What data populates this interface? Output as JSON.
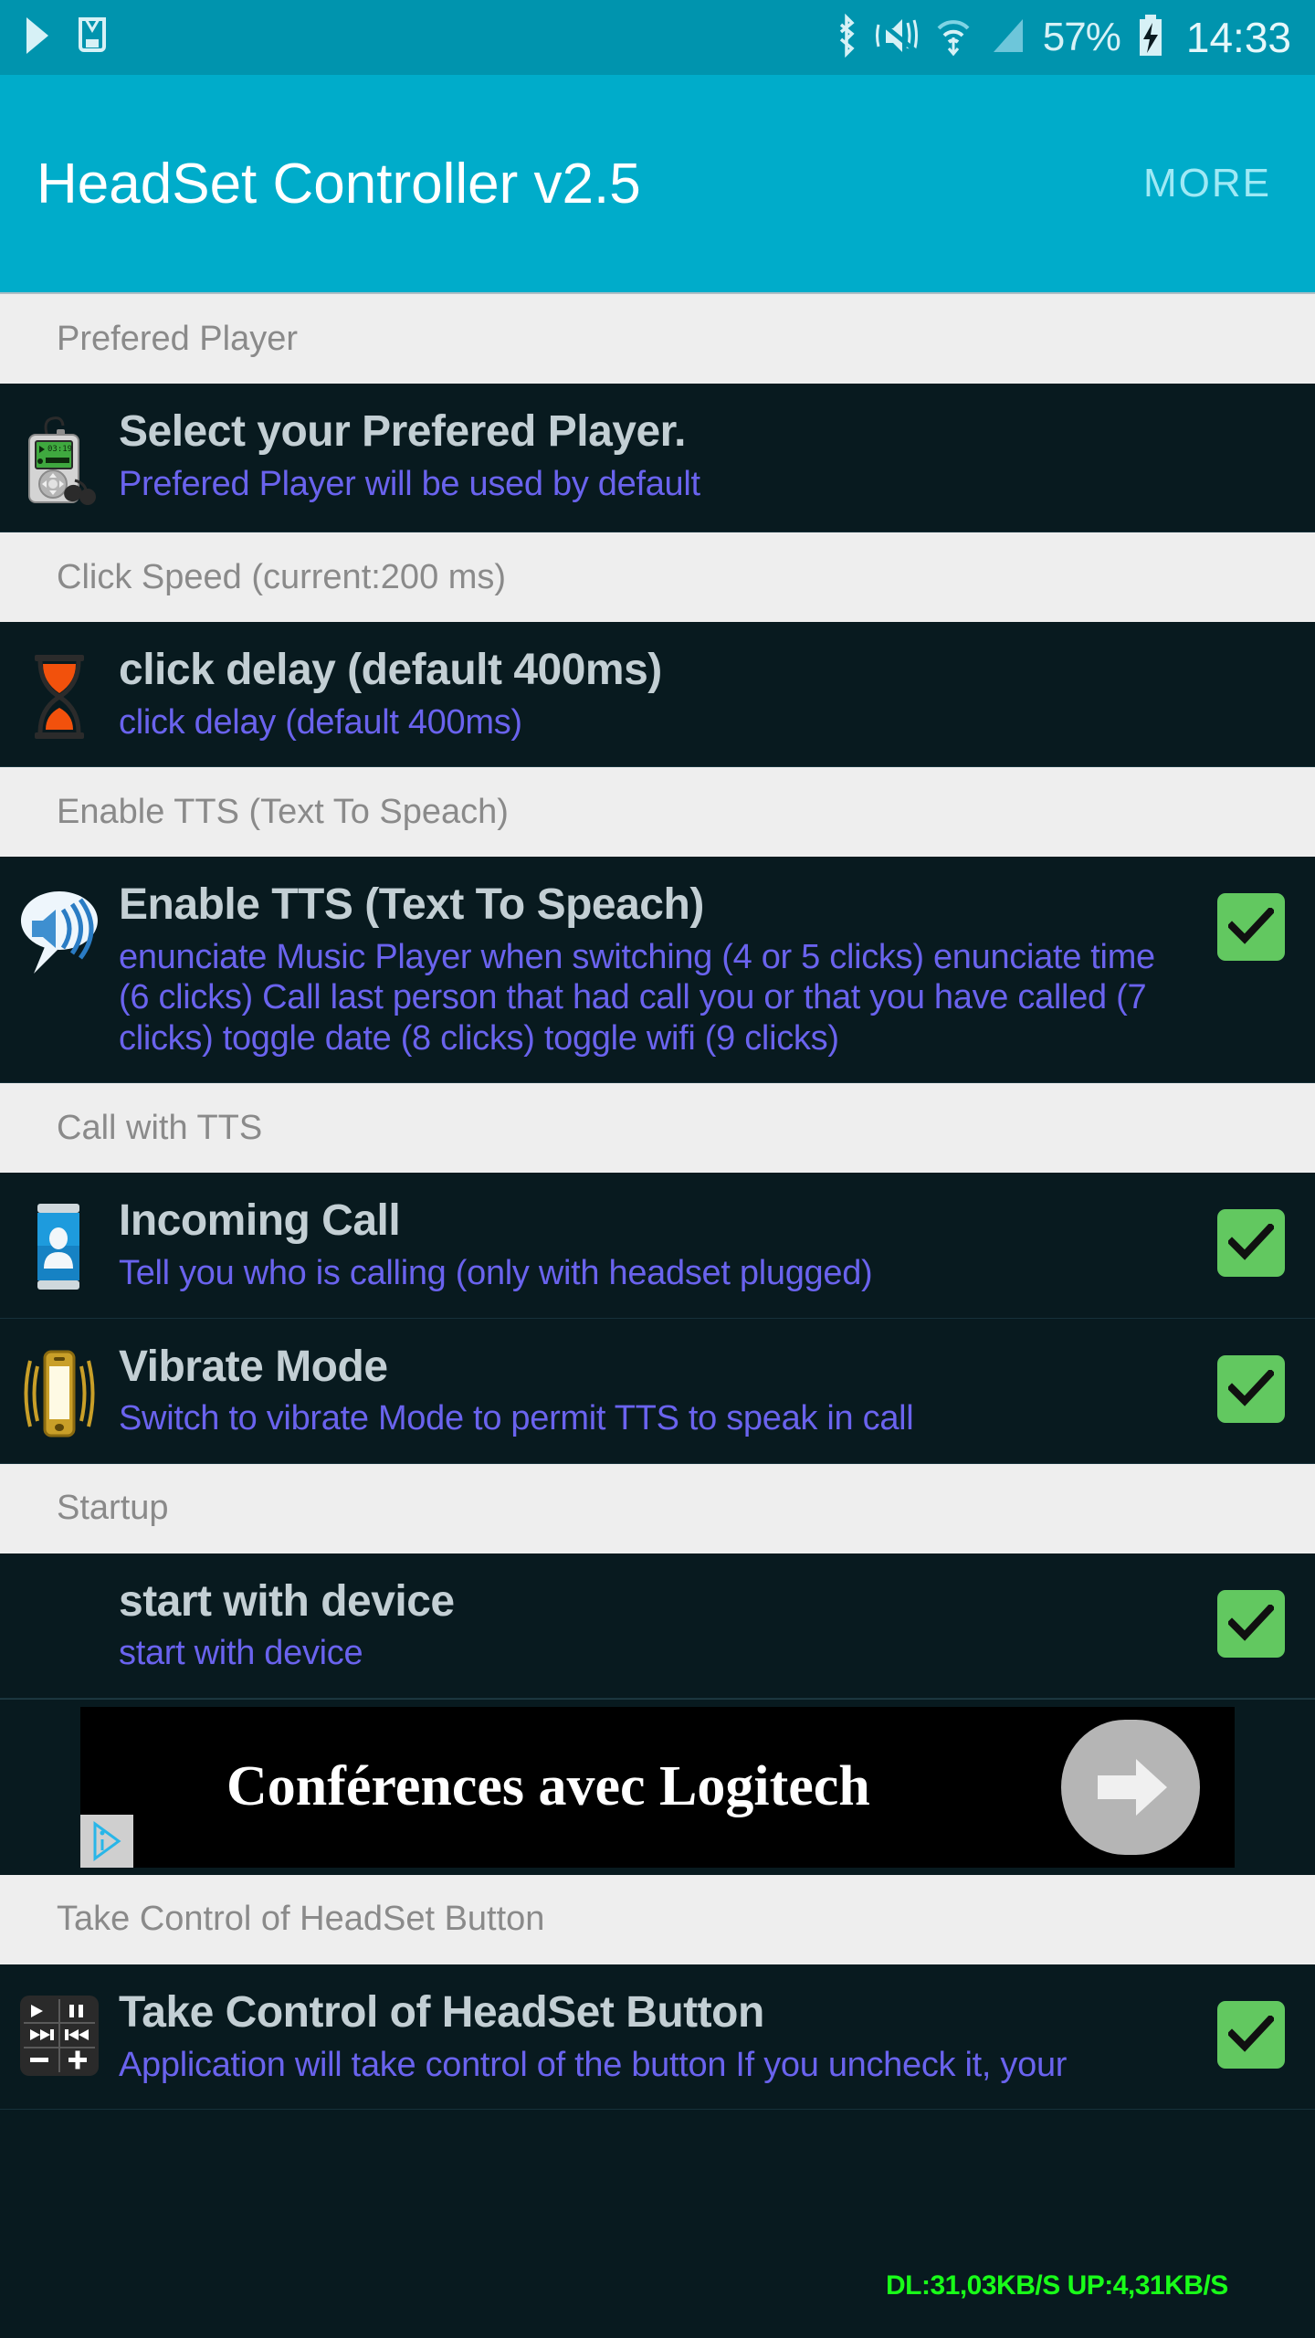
{
  "status_bar": {
    "left_icons": [
      "play-icon",
      "mail-icon"
    ],
    "right_icons": [
      "bluetooth-icon",
      "mute-icon",
      "wifi-icon",
      "signal-icon"
    ],
    "battery_percent": "57%",
    "battery_state": "charging",
    "clock": "14:33"
  },
  "app_bar": {
    "title": "HeadSet Controller v2.5",
    "more_label": "MORE"
  },
  "sections": [
    {
      "header": "Prefered Player",
      "rows": [
        {
          "icon": "mp3-player-icon",
          "title": "Select your Prefered Player.",
          "subtitle": "Prefered Player will be used by default",
          "checkbox": false
        }
      ]
    },
    {
      "header": "Click Speed (current:200 ms)",
      "rows": [
        {
          "icon": "hourglass-icon",
          "title": "click delay (default 400ms)",
          "subtitle": "click delay (default 400ms)",
          "checkbox": false
        }
      ]
    },
    {
      "header": "Enable TTS (Text To Speach)",
      "rows": [
        {
          "icon": "speech-bubble-speaker-icon",
          "title": "Enable TTS (Text To Speach)",
          "subtitle": "enunciate Music Player when switching (4 or 5 clicks) enunciate time (6 clicks) Call last person that had call you or that you have called (7 clicks) toggle date (8 clicks) toggle wifi (9 clicks)",
          "checkbox": true
        }
      ]
    },
    {
      "header": "Call with TTS",
      "rows": [
        {
          "icon": "contact-card-icon",
          "title": "Incoming Call",
          "subtitle": "Tell you who is calling (only with headset plugged)",
          "checkbox": true
        },
        {
          "icon": "vibrating-phone-icon",
          "title": "Vibrate Mode",
          "subtitle": "Switch to vibrate Mode to permit TTS to speak in call",
          "checkbox": true
        }
      ]
    },
    {
      "header": "Startup",
      "rows": [
        {
          "icon": "none",
          "title": "start with device",
          "subtitle": "start with device",
          "checkbox": true
        }
      ]
    }
  ],
  "ad": {
    "text": "Conférences avec Logitech",
    "arrow_icon": "arrow-right-icon",
    "adchoices_icon": "adchoices-icon"
  },
  "last_section": {
    "header": "Take Control of HeadSet Button",
    "row": {
      "icon": "media-controls-icon",
      "title": "Take Control of HeadSet Button",
      "subtitle": "Application will take control of the button If you uncheck it, your",
      "checkbox": true
    }
  },
  "network_speed": {
    "text": "DL:31,03KB/S UP:4,31KB/S"
  },
  "colors": {
    "status_bar_bg": "#0094ae",
    "app_bar_bg": "#00acca",
    "section_header_bg": "#eeeeee",
    "row_bg": "#081a1f",
    "title_text": "#c3cfd4",
    "subtitle_text": "#6a63ee",
    "checkbox_green": "#62c860",
    "net_speed_green": "#19ff19"
  }
}
